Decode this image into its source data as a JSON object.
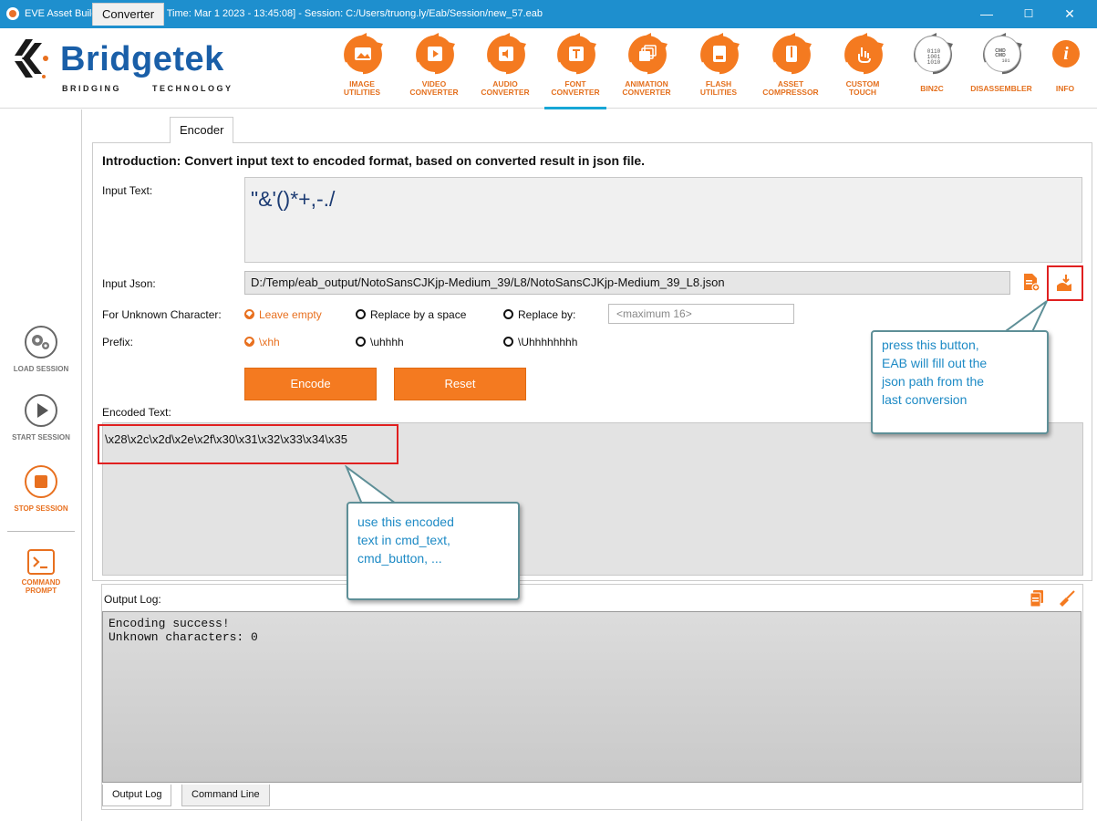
{
  "window": {
    "title": "EVE Asset Builder v2.9.0 [Build Time: Mar  1 2023 - 13:45:08] - Session: C:/Users/truong.ly/Eab/Session/new_57.eab",
    "minimize": "—",
    "maximize": "☐",
    "close": "✕"
  },
  "brand": {
    "name": "Bridgetek",
    "tagline_left": "BRIDGING",
    "tagline_right": "TECHNOLOGY",
    "color": "#1a5fa8"
  },
  "toolbar": {
    "accent": "#f47a20",
    "items": [
      {
        "label": "IMAGE\nUTILITIES",
        "icon": "image-icon"
      },
      {
        "label": "VIDEO\nCONVERTER",
        "icon": "video-icon"
      },
      {
        "label": "AUDIO\nCONVERTER",
        "icon": "audio-icon"
      },
      {
        "label": "FONT\nCONVERTER",
        "icon": "font-icon",
        "active": true
      },
      {
        "label": "ANIMATION\nCONVERTER",
        "icon": "animation-icon"
      },
      {
        "label": "FLASH\nUTILITIES",
        "icon": "flash-icon"
      },
      {
        "label": "ASSET\nCOMPRESSOR",
        "icon": "compressor-icon"
      },
      {
        "label": "CUSTOM\nTOUCH",
        "icon": "touch-icon"
      },
      {
        "label": "BIN2C",
        "icon": "binary-icon"
      },
      {
        "label": "DISASSEMBLER",
        "icon": "disassembler-icon"
      },
      {
        "label": "INFO",
        "icon": "info-icon"
      }
    ]
  },
  "sidebar": {
    "load_session": "LOAD SESSION",
    "start_session": "START SESSION",
    "stop_session": "STOP SESSION",
    "command_prompt": "COMMAND\nPROMPT"
  },
  "tabs": {
    "converter": "Converter",
    "encoder": "Encoder"
  },
  "encoder": {
    "intro": "Introduction: Convert input text to encoded format, based on converted result in json file.",
    "input_text_label": "Input Text:",
    "input_text_value": "\"&'()*+,-./",
    "input_json_label": "Input Json:",
    "input_json_value": "D:/Temp/eab_output/NotoSansCJKjp-Medium_39/L8/NotoSansCJKjp-Medium_39_L8.json",
    "unknown_label": "For Unknown Character:",
    "unknown_options": [
      "Leave empty",
      "Replace by a space",
      "Replace by:"
    ],
    "replace_placeholder": "<maximum 16>",
    "prefix_label": "Prefix:",
    "prefix_options": [
      "\\xhh",
      "\\uhhhh",
      "\\Uhhhhhhhh"
    ],
    "encode_button": "Encode",
    "reset_button": "Reset",
    "encoded_label": "Encoded Text:",
    "encoded_value": "\\x28\\x2c\\x2d\\x2e\\x2f\\x30\\x31\\x32\\x33\\x34\\x35"
  },
  "log": {
    "label": "Output Log:",
    "text": "Encoding success!\nUnknown characters: 0",
    "tab_output": "Output Log",
    "tab_command": "Command Line"
  },
  "callouts": {
    "json_tip": "press this button,\nEAB will fill out the\njson path from the\nlast conversion",
    "encoded_tip": "use this encoded\ntext in cmd_text,\ncmd_button, ..."
  }
}
